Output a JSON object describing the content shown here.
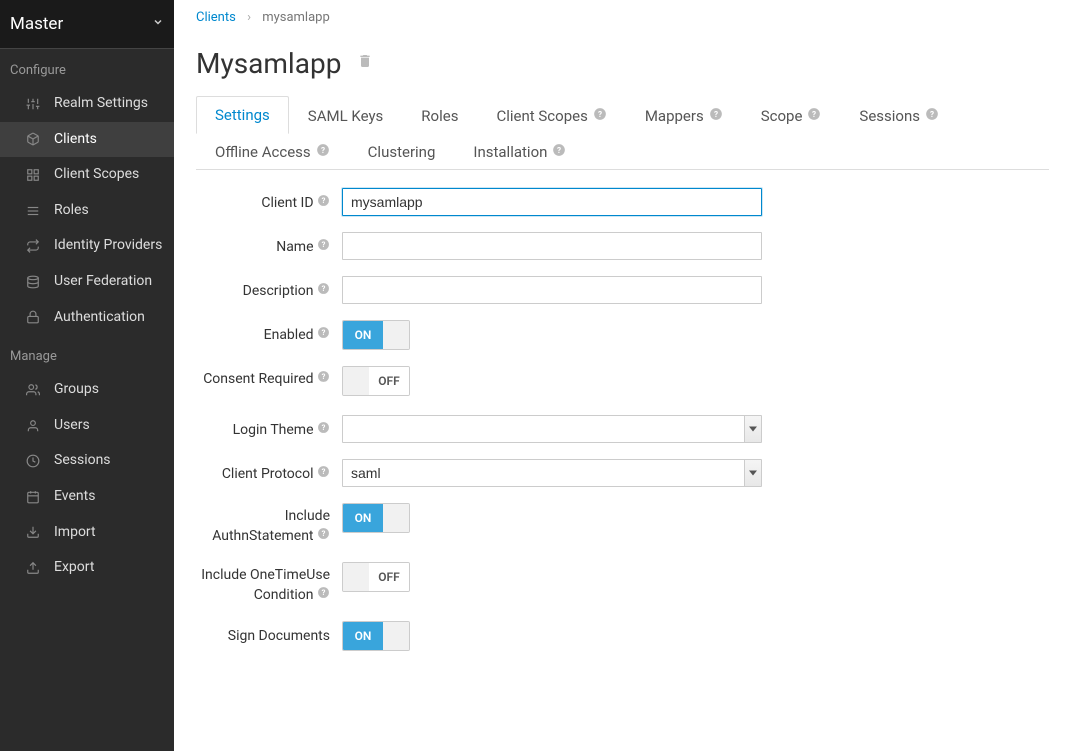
{
  "realm_selector": "Master",
  "sidebar": {
    "section_configure": "Configure",
    "section_manage": "Manage",
    "configure_items": [
      {
        "label": "Realm Settings",
        "icon": "sliders"
      },
      {
        "label": "Clients",
        "icon": "cube",
        "active": true
      },
      {
        "label": "Client Scopes",
        "icon": "cubes"
      },
      {
        "label": "Roles",
        "icon": "list"
      },
      {
        "label": "Identity Providers",
        "icon": "exchange"
      },
      {
        "label": "User Federation",
        "icon": "database"
      },
      {
        "label": "Authentication",
        "icon": "lock"
      }
    ],
    "manage_items": [
      {
        "label": "Groups",
        "icon": "users"
      },
      {
        "label": "Users",
        "icon": "user"
      },
      {
        "label": "Sessions",
        "icon": "clock"
      },
      {
        "label": "Events",
        "icon": "calendar"
      },
      {
        "label": "Import",
        "icon": "import"
      },
      {
        "label": "Export",
        "icon": "export"
      }
    ]
  },
  "breadcrumb": {
    "parent": "Clients",
    "current": "mysamlapp"
  },
  "page_title": "Mysamlapp",
  "tabs": [
    {
      "label": "Settings",
      "active": true,
      "help": false
    },
    {
      "label": "SAML Keys",
      "help": false
    },
    {
      "label": "Roles",
      "help": false
    },
    {
      "label": "Client Scopes",
      "help": true
    },
    {
      "label": "Mappers",
      "help": true
    },
    {
      "label": "Scope",
      "help": true
    },
    {
      "label": "Sessions",
      "help": true
    },
    {
      "label": "Offline Access",
      "help": true
    },
    {
      "label": "Clustering",
      "help": false
    },
    {
      "label": "Installation",
      "help": true
    }
  ],
  "form": {
    "client_id": {
      "label": "Client ID",
      "value": "mysamlapp"
    },
    "name": {
      "label": "Name",
      "value": ""
    },
    "description": {
      "label": "Description",
      "value": ""
    },
    "enabled": {
      "label": "Enabled",
      "value": "ON"
    },
    "consent_required": {
      "label": "Consent Required",
      "value": "OFF"
    },
    "login_theme": {
      "label": "Login Theme",
      "value": ""
    },
    "client_protocol": {
      "label": "Client Protocol",
      "value": "saml"
    },
    "include_authn_statement": {
      "label": "Include AuthnStatement",
      "value": "ON"
    },
    "include_onetimeuse": {
      "label": "Include OneTimeUse Condition",
      "value": "OFF"
    },
    "sign_documents": {
      "label": "Sign Documents",
      "value": "ON"
    }
  },
  "toggle_labels": {
    "on": "ON",
    "off": "OFF"
  }
}
